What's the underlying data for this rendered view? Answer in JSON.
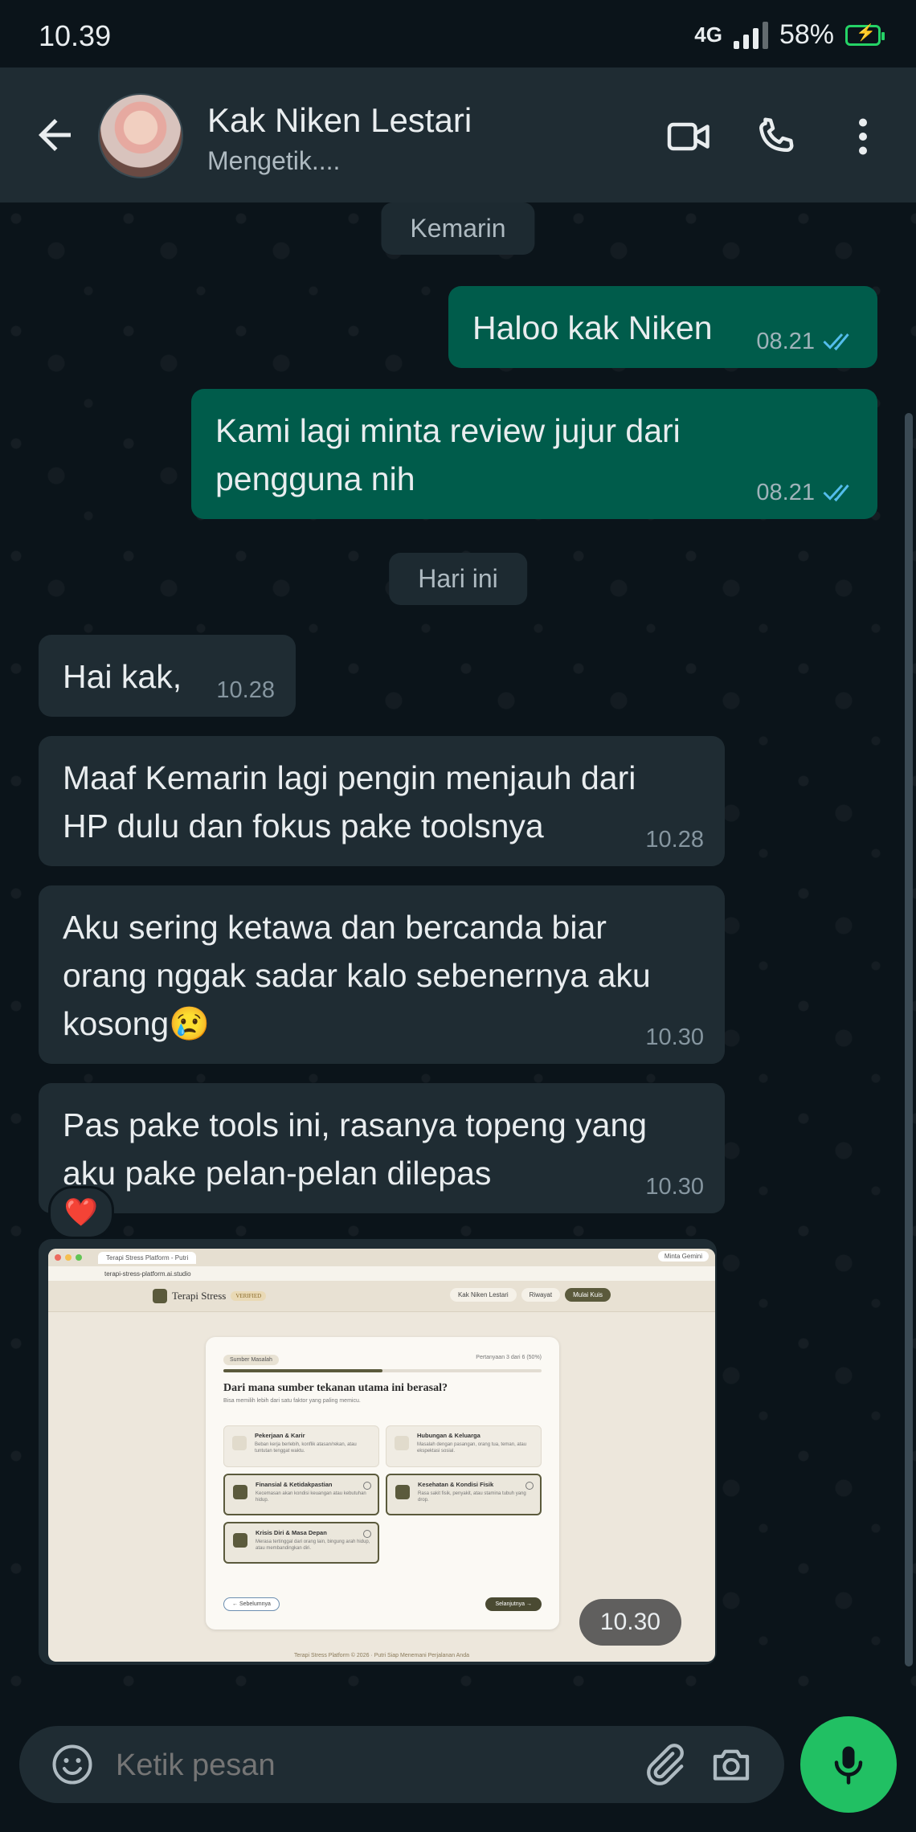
{
  "status_bar": {
    "time": "10.39",
    "network": "4G",
    "battery": "58%"
  },
  "header": {
    "contact_name": "Kak Niken Lestari",
    "status": "Mengetik...."
  },
  "dates": {
    "yesterday": "Kemarin",
    "today": "Hari ini"
  },
  "messages": [
    {
      "direction": "out",
      "text": "Haloo kak Niken",
      "time": "08.21",
      "read": true
    },
    {
      "direction": "out",
      "text": "Kami lagi minta review jujur dari pengguna nih",
      "time": "08.21",
      "read": true
    },
    {
      "direction": "in",
      "text": "Hai kak,",
      "time": "10.28"
    },
    {
      "direction": "in",
      "text": "Maaf Kemarin lagi pengin menjauh dari HP dulu dan fokus pake toolsnya",
      "time": "10.28"
    },
    {
      "direction": "in",
      "text": "Aku sering ketawa dan bercanda biar orang nggak sadar kalo sebenernya aku kosong😢",
      "time": "10.30"
    },
    {
      "direction": "in",
      "text": "Pas pake tools ini, rasanya topeng yang aku pake pelan-pelan dilepas",
      "time": "10.30",
      "reaction": "❤️"
    }
  ],
  "image_message": {
    "time": "10.30",
    "screenshot": {
      "tab_title": "Terapi Stress Platform - Putri",
      "gemini_button": "Minta Gemini",
      "url": "terapi-stress-platform.ai.studio",
      "brand": "Terapi Stress",
      "brand_badge": "VERIFIED",
      "nav": [
        "Kak Niken Lestari",
        "Riwayat",
        "Mulai Kuis"
      ],
      "question_tag": "Sumber Masalah",
      "progress_text": "Pertanyaan 3 dari 6 (50%)",
      "progress": 0.5,
      "question": "Dari mana sumber tekanan utama ini berasal?",
      "question_hint": "Bisa memilih lebih dari satu faktor yang paling memicu.",
      "options": [
        {
          "title": "Pekerjaan & Karir",
          "desc": "Beban kerja berlebih, konflik atasan/rekan, atau tuntutan tenggat waktu.",
          "selected": false
        },
        {
          "title": "Hubungan & Keluarga",
          "desc": "Masalah dengan pasangan, orang tua, teman, atau ekspektasi sosial.",
          "selected": false
        },
        {
          "title": "Finansial & Ketidakpastian",
          "desc": "Kecemasan akan kondisi keuangan atau kebutuhan hidup.",
          "selected": true
        },
        {
          "title": "Kesehatan & Kondisi Fisik",
          "desc": "Rasa sakit fisik, penyakit, atau stamina tubuh yang drop.",
          "selected": true
        },
        {
          "title": "Krisis Diri & Masa Depan",
          "desc": "Merasa tertinggal dari orang lain, bingung arah hidup, atau membandingkan diri.",
          "selected": true
        }
      ],
      "prev_label": "Sebelumnya",
      "next_label": "Selanjutnya",
      "footer": "Terapi Stress Platform © 2026 · Putri Siap Menemani Perjalanan Anda"
    }
  },
  "input": {
    "placeholder": "Ketik pesan"
  },
  "colors": {
    "outgoing": "#005c4b",
    "incoming": "#1f2c33",
    "accent": "#21c063",
    "ticks": "#53bdeb"
  }
}
